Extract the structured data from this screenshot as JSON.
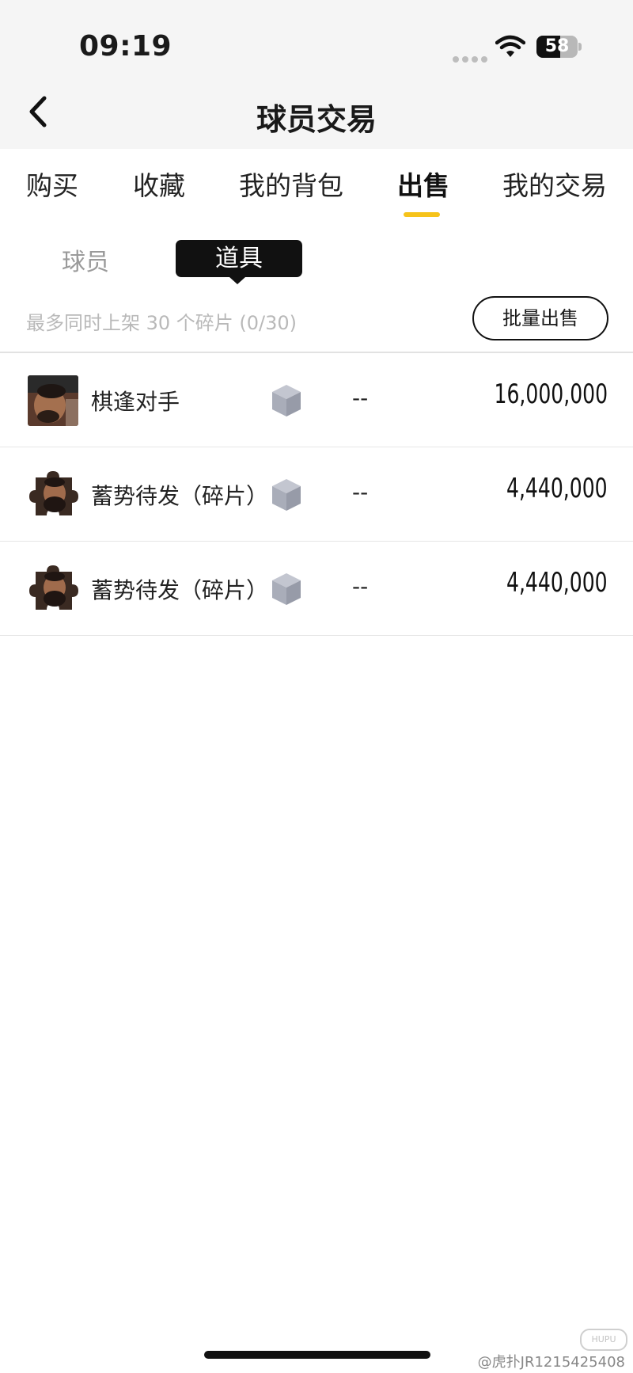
{
  "status_bar": {
    "time": "09:19",
    "battery": "58",
    "battery_level": 0.58
  },
  "header": {
    "title": "球员交易"
  },
  "tabs": [
    {
      "label": "购买"
    },
    {
      "label": "收藏"
    },
    {
      "label": "我的背包"
    },
    {
      "label": "出售",
      "active": true
    },
    {
      "label": "我的交易"
    }
  ],
  "subtabs": {
    "players": "球员",
    "items": "道具",
    "active": "道具"
  },
  "listing": {
    "limit_text": "最多同时上架 30 个碎片 (0/30)",
    "bulk_sell_label": "批量出售"
  },
  "items": [
    {
      "name": "棋逢对手",
      "status": "--",
      "price": "16,000,000"
    },
    {
      "name": "蓄势待发（碎片）",
      "status": "--",
      "price": "4,440,000"
    },
    {
      "name": "蓄势待发（碎片）",
      "status": "--",
      "price": "4,440,000"
    }
  ],
  "watermark": {
    "text": "@虎扑JR1215425408",
    "logo": "HUPU"
  },
  "colors": {
    "accent": "#f6c31a",
    "cube": "#a9adb9"
  }
}
